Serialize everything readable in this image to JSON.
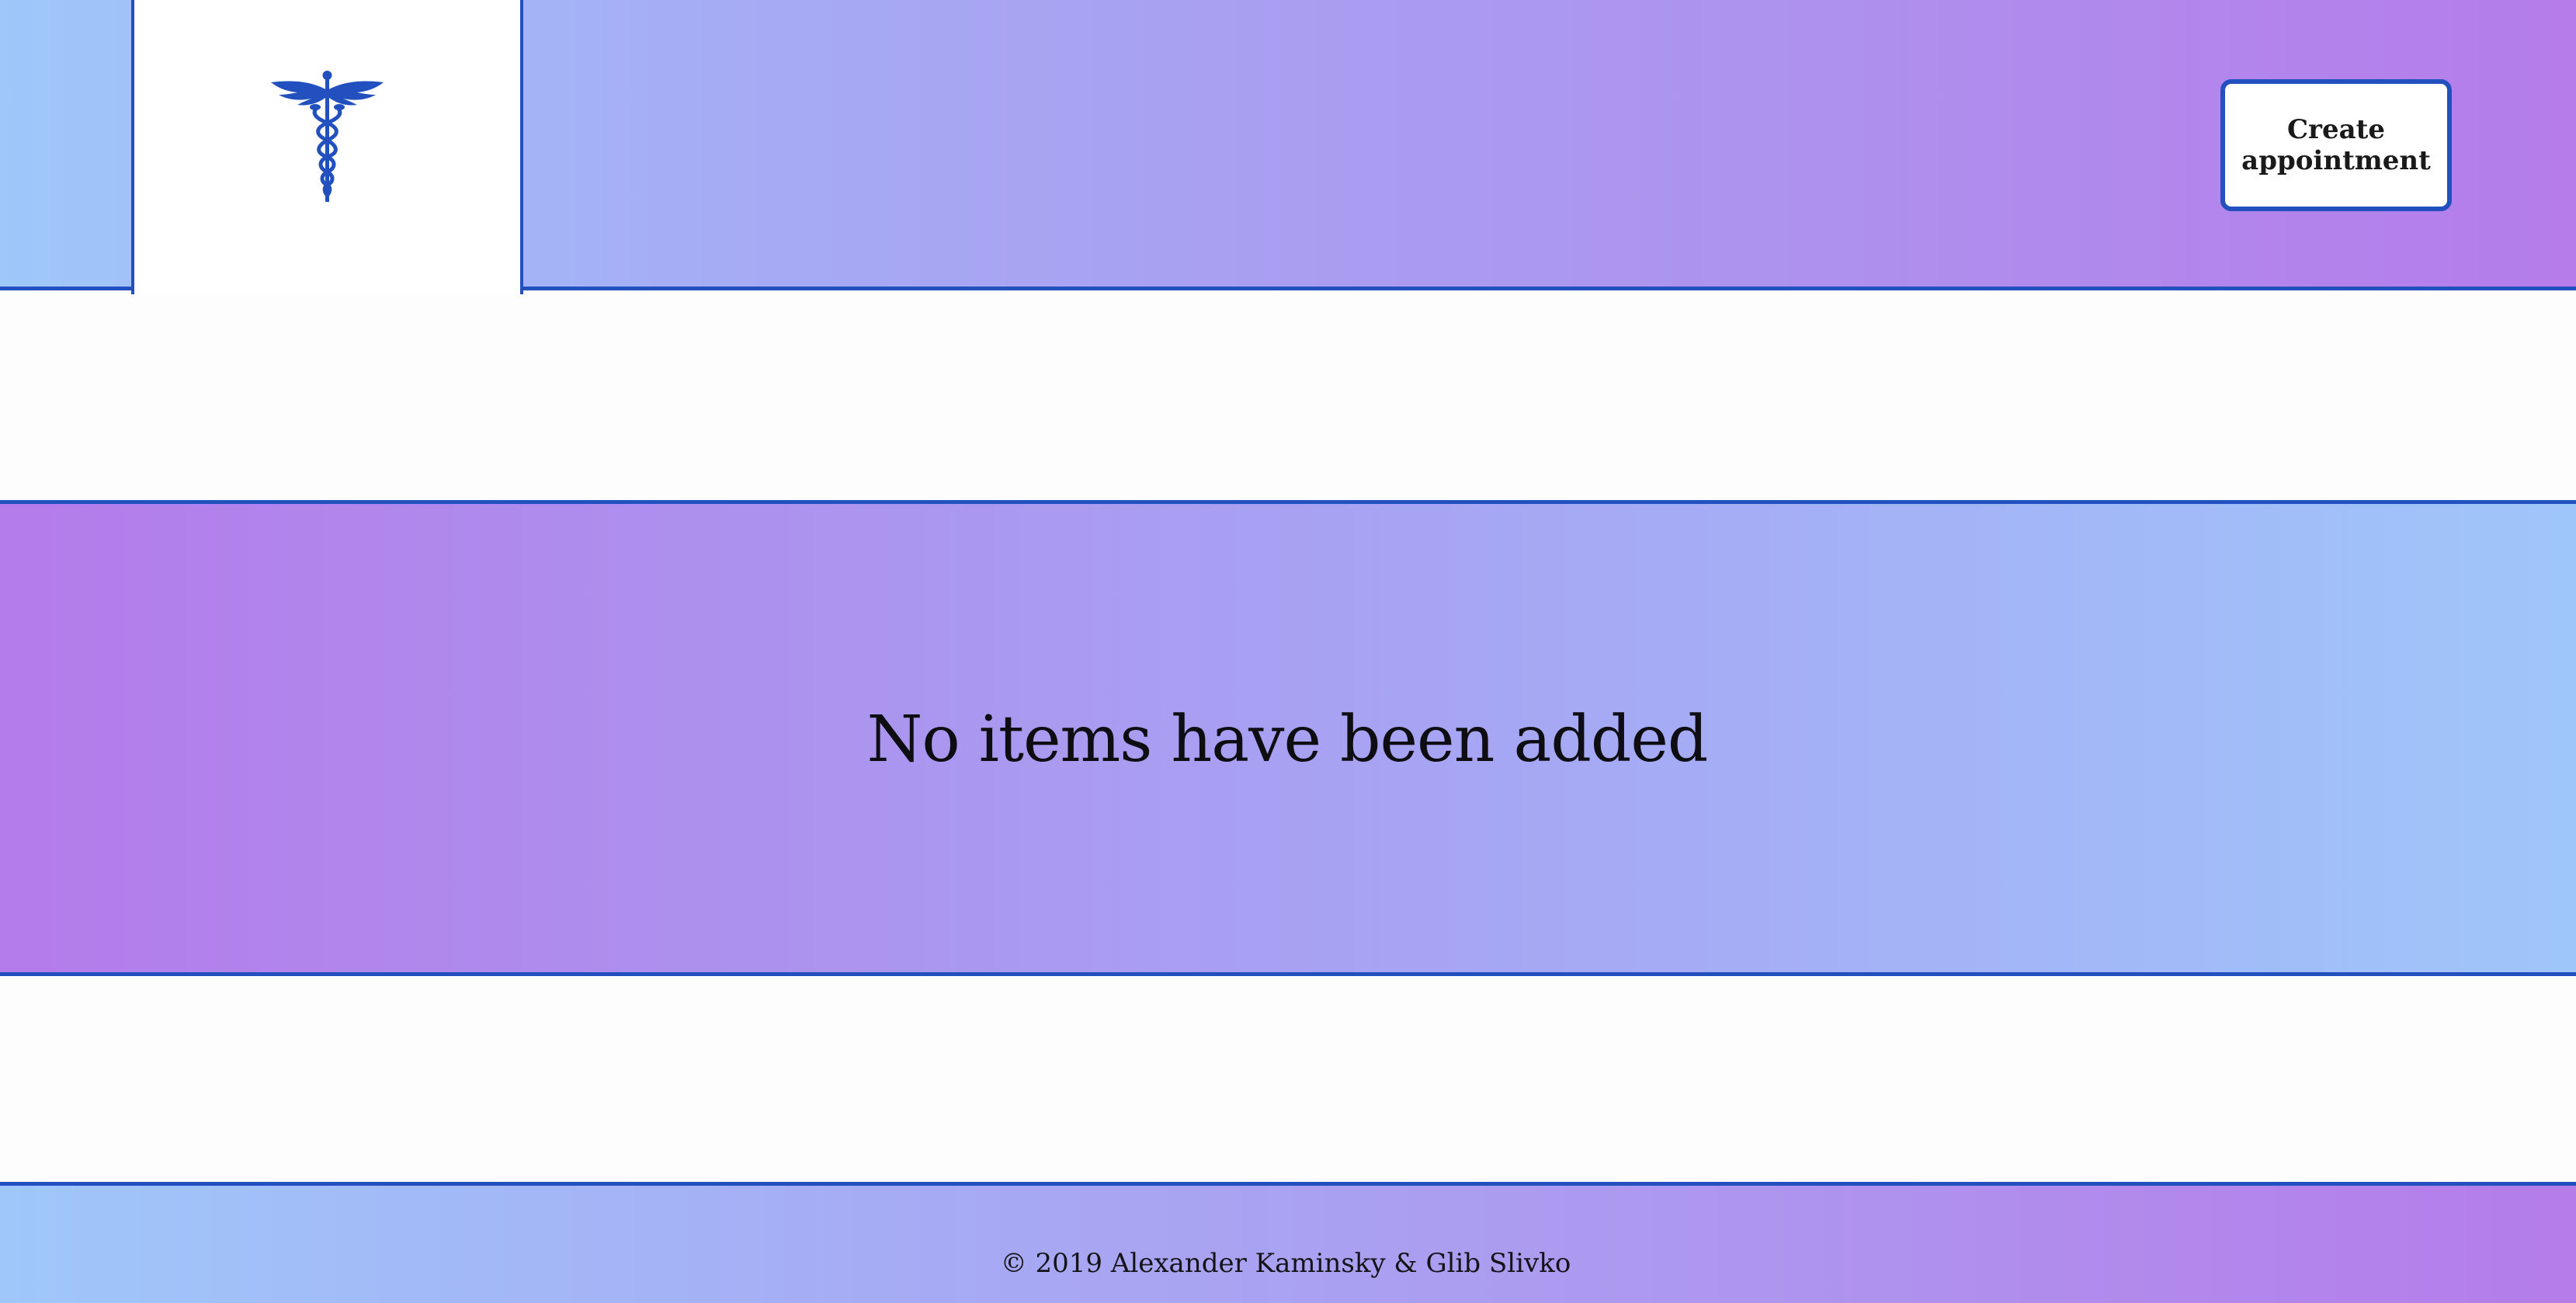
{
  "header": {
    "logo": {
      "icon": "caduceus-icon",
      "color": "#2251bf"
    },
    "create_button_label": "Create appointment"
  },
  "main": {
    "empty_message": "No items have been added"
  },
  "footer": {
    "copyright": "© 2019 Alexander Kaminsky & Glib Slivko"
  },
  "colors": {
    "border": "#2251bf",
    "gradient_blue": "#9fc7fa",
    "gradient_purple": "#b57cea"
  }
}
